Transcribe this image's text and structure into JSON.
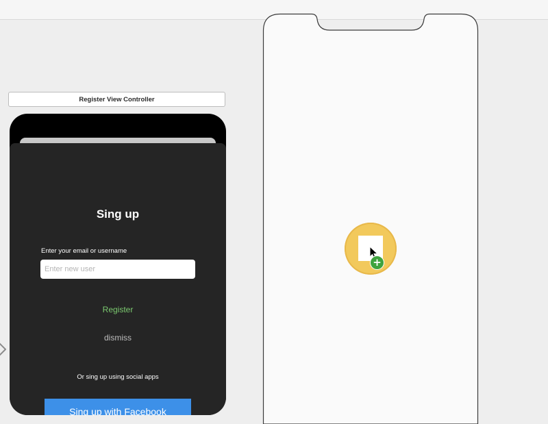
{
  "scene": {
    "title": "Register View Controller"
  },
  "register": {
    "title": "Sing up",
    "field_label": "Enter your email or username",
    "input_placeholder": "Enter new user",
    "input_value": "",
    "register_label": "Register",
    "dismiss_label": "dismiss",
    "social_label": "Or sing up using social apps",
    "facebook_label": "Sing up with Facebook"
  },
  "drop_target": {
    "icon": "add-object-icon",
    "badge": "+"
  },
  "colors": {
    "register_text": "#7bc96f",
    "facebook_button": "#3d90e8",
    "sheet_background": "#252525",
    "drop_target": "#f2c95c",
    "add_badge": "#3ea33e"
  },
  "icons": {
    "entry_arrow": "arrow-right-icon",
    "cursor": "pointer-cursor-icon",
    "add_badge": "plus-circle-icon"
  }
}
